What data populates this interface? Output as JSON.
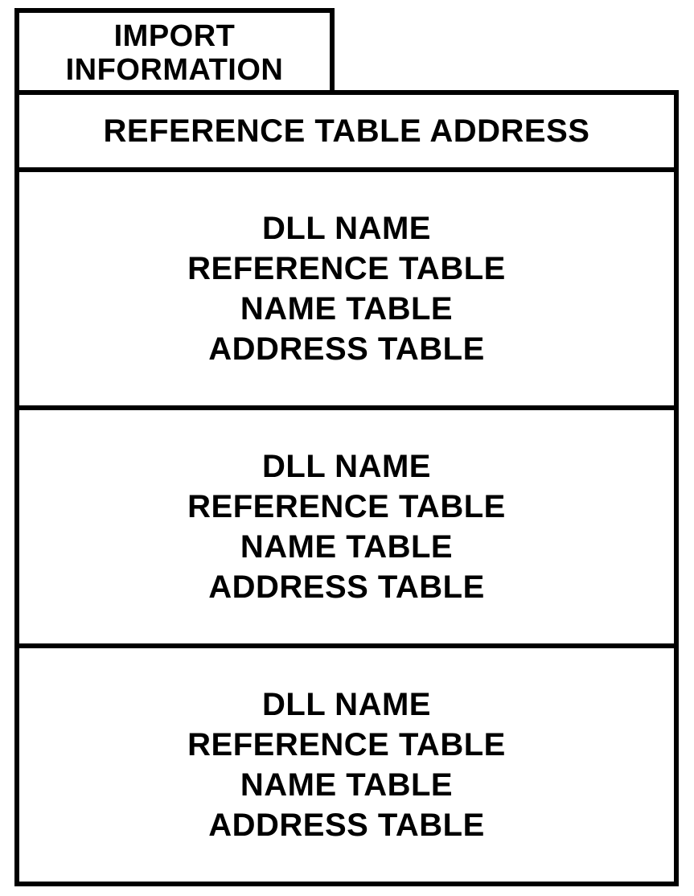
{
  "tab": {
    "line1": "IMPORT",
    "line2": "INFORMATION"
  },
  "header": "REFERENCE TABLE ADDRESS",
  "blocks": [
    {
      "l1": "DLL NAME",
      "l2": "REFERENCE TABLE",
      "l3": "NAME TABLE",
      "l4": "ADDRESS TABLE"
    },
    {
      "l1": "DLL NAME",
      "l2": "REFERENCE TABLE",
      "l3": "NAME TABLE",
      "l4": "ADDRESS TABLE"
    },
    {
      "l1": "DLL NAME",
      "l2": "REFERENCE TABLE",
      "l3": "NAME TABLE",
      "l4": "ADDRESS TABLE"
    }
  ]
}
